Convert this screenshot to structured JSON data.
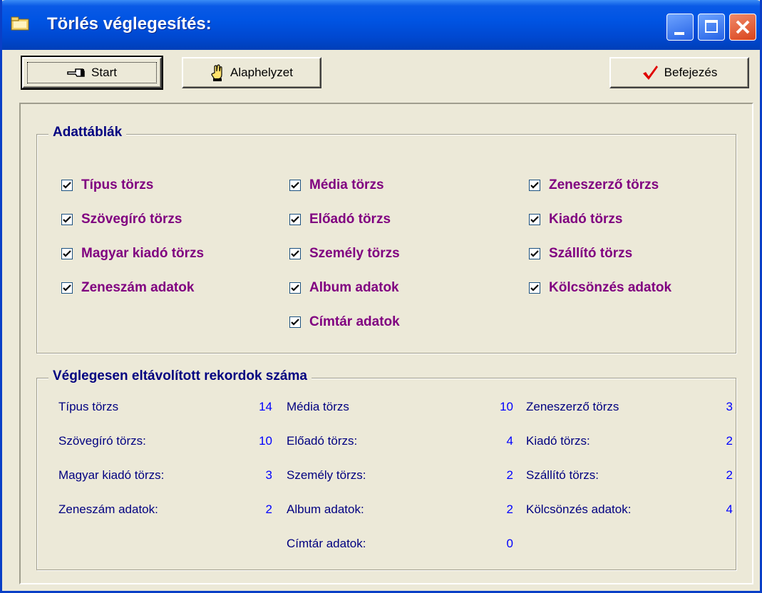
{
  "window": {
    "title": "Törlés véglegesítés:"
  },
  "toolbar": {
    "start_label": "Start",
    "reset_label": "Alaphelyzet",
    "finish_label": "Befejezés"
  },
  "tables_group": {
    "title": "Adattáblák",
    "columns": [
      [
        {
          "label": "Típus törzs",
          "checked": true
        },
        {
          "label": "Szövegíró törzs",
          "checked": true
        },
        {
          "label": "Magyar kiadó törzs",
          "checked": true
        },
        {
          "label": "Zeneszám adatok",
          "checked": true
        }
      ],
      [
        {
          "label": "Média törzs",
          "checked": true
        },
        {
          "label": "Előadó törzs",
          "checked": true
        },
        {
          "label": "Személy törzs",
          "checked": true
        },
        {
          "label": "Album adatok",
          "checked": true
        },
        {
          "label": "Címtár adatok",
          "checked": true
        }
      ],
      [
        {
          "label": "Zeneszerző törzs",
          "checked": true
        },
        {
          "label": "Kiadó törzs",
          "checked": true
        },
        {
          "label": "Szállító törzs",
          "checked": true
        },
        {
          "label": "Kölcsönzés adatok",
          "checked": true
        }
      ]
    ]
  },
  "records_group": {
    "title": "Véglegesen eltávolított rekordok száma",
    "columns": [
      [
        {
          "label": "Típus törzs",
          "value": "14"
        },
        {
          "label": "Szövegíró törzs:",
          "value": "10"
        },
        {
          "label": "Magyar kiadó törzs:",
          "value": "3"
        },
        {
          "label": "Zeneszám adatok:",
          "value": "2"
        }
      ],
      [
        {
          "label": "Média törzs",
          "value": "10"
        },
        {
          "label": "Előadó törzs:",
          "value": "4"
        },
        {
          "label": "Személy törzs:",
          "value": "2"
        },
        {
          "label": "Album adatok:",
          "value": "2"
        },
        {
          "label": "Címtár adatok:",
          "value": "0"
        }
      ],
      [
        {
          "label": "Zeneszerző törzs",
          "value": "3"
        },
        {
          "label": "Kiadó törzs:",
          "value": "2"
        },
        {
          "label": "Szállító törzs:",
          "value": "2"
        },
        {
          "label": "Kölcsönzés adatok:",
          "value": "4"
        }
      ]
    ]
  }
}
